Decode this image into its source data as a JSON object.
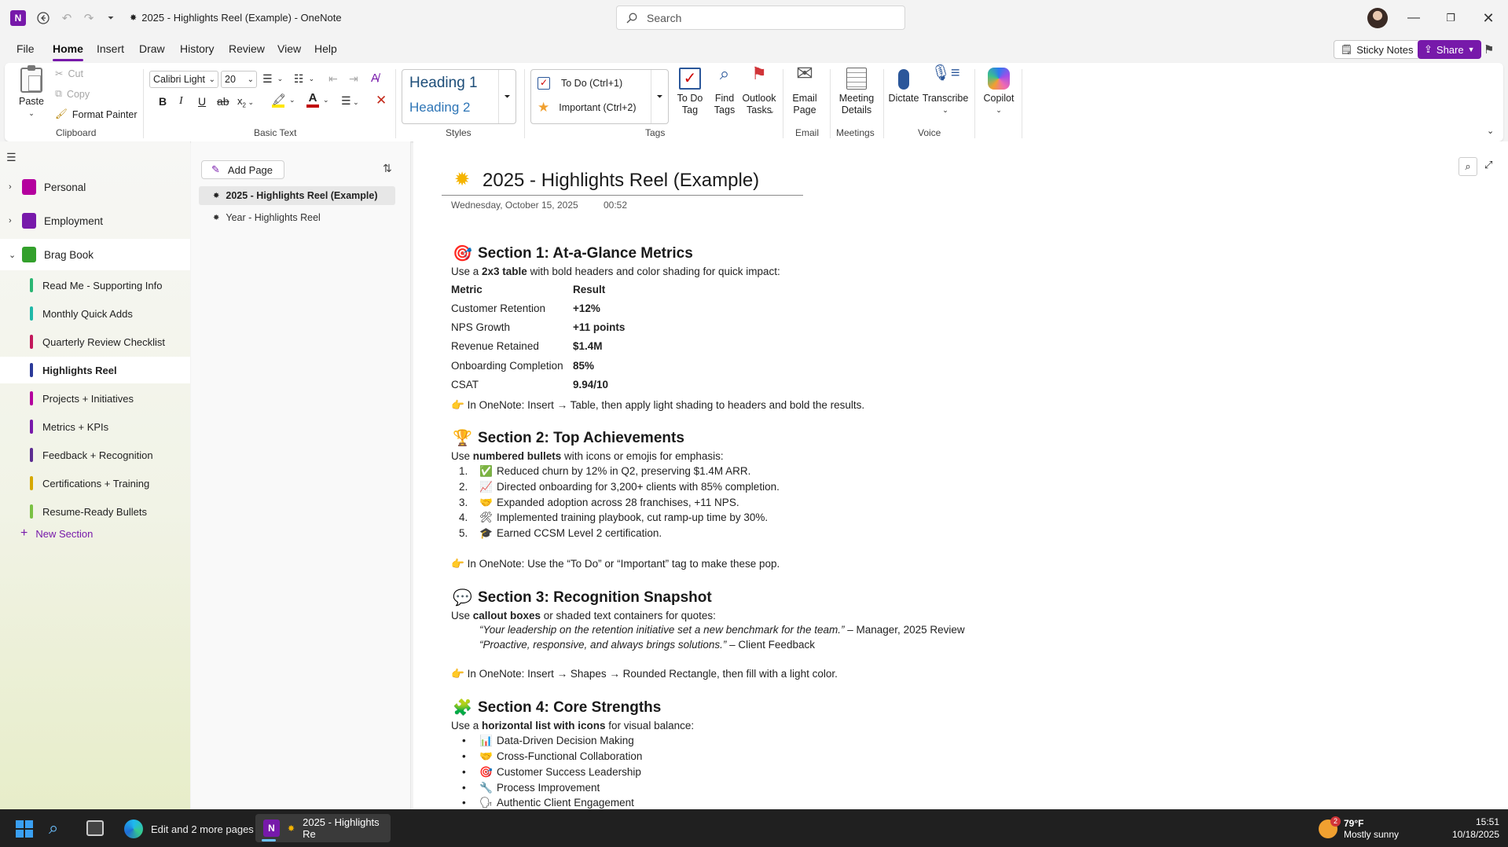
{
  "window": {
    "title": "2025 - Highlights Reel (Example)  -  OneNote",
    "search_placeholder": "Search"
  },
  "menu": [
    "File",
    "Home",
    "Insert",
    "Draw",
    "History",
    "Review",
    "View",
    "Help"
  ],
  "menu_right": {
    "sticky_notes": "Sticky Notes",
    "share": "Share"
  },
  "ribbon": {
    "clipboard": {
      "paste": "Paste",
      "cut": "Cut",
      "copy": "Copy",
      "format_painter": "Format Painter",
      "label": "Clipboard"
    },
    "basic_text": {
      "font": "Calibri Light",
      "size": "20",
      "label": "Basic Text"
    },
    "styles": {
      "h1": "Heading 1",
      "h2": "Heading 2",
      "label": "Styles"
    },
    "tags": {
      "todo": "To Do (Ctrl+1)",
      "important": "Important (Ctrl+2)",
      "todo_tag": "To Do Tag",
      "find_tags": "Find Tags",
      "outlook_tasks": "Outlook Tasks",
      "label": "Tags"
    },
    "email": {
      "email_page": "Email Page",
      "label": "Email"
    },
    "meetings": {
      "meeting_details": "Meeting Details",
      "label": "Meetings"
    },
    "voice": {
      "dictate": "Dictate",
      "transcribe": "Transcribe",
      "label": "Voice"
    },
    "copilot": {
      "label": "Copilot"
    }
  },
  "notebooks": [
    {
      "name": "Personal",
      "color": "#b4009e"
    },
    {
      "name": "Employment",
      "color": "#7719aa"
    },
    {
      "name": "Brag Book",
      "color": "#33a02c"
    }
  ],
  "sections": [
    {
      "name": "Read Me - Supporting Info",
      "color": "#2bb673"
    },
    {
      "name": "Monthly Quick Adds",
      "color": "#1fb8a8"
    },
    {
      "name": "Quarterly Review Checklist",
      "color": "#c2185b"
    },
    {
      "name": "Highlights Reel",
      "color": "#2b3a99"
    },
    {
      "name": "Projects + Initiatives",
      "color": "#b4009e"
    },
    {
      "name": "Metrics + KPIs",
      "color": "#7719aa"
    },
    {
      "name": "Feedback + Recognition",
      "color": "#5c2d91"
    },
    {
      "name": "Certifications + Training",
      "color": "#d6a800"
    },
    {
      "name": "Resume-Ready Bullets",
      "color": "#7ac143"
    }
  ],
  "new_section": "New Section",
  "pages": {
    "add_page": "Add Page",
    "items": [
      "2025 - Highlights Reel (Example)",
      "Year - Highlights Reel"
    ]
  },
  "note": {
    "title": "2025 - Highlights Reel (Example)",
    "date": "Wednesday, October 15, 2025",
    "time": "00:52",
    "s1": {
      "heading": "Section 1: At-a-Glance Metrics",
      "intro_pre": "Use a ",
      "intro_bold": "2x3 table",
      "intro_post": " with bold headers and color shading for quick impact:",
      "header": [
        "Metric",
        "Result"
      ],
      "rows": [
        [
          "Customer Retention",
          "+12%"
        ],
        [
          "NPS Growth",
          "+11 points"
        ],
        [
          "Revenue Retained",
          "$1.4M"
        ],
        [
          "Onboarding Completion",
          "85%"
        ],
        [
          "CSAT",
          "9.94/10"
        ]
      ],
      "tip": "In OneNote: Insert → Table, then apply light shading to headers and bold the results."
    },
    "s2": {
      "heading": "Section 2: Top Achievements",
      "intro_pre": "Use ",
      "intro_bold": "numbered bullets",
      "intro_post": " with icons or emojis for emphasis:",
      "items": [
        {
          "n": "1.",
          "icon": "✅",
          "text": "Reduced churn by 12% in Q2, preserving $1.4M ARR."
        },
        {
          "n": "2.",
          "icon": "📈",
          "text": "Directed onboarding for 3,200+ clients with 85% completion."
        },
        {
          "n": "3.",
          "icon": "🤝",
          "text": "Expanded adoption across 28 franchises, +11 NPS."
        },
        {
          "n": "4.",
          "icon": "🛠",
          "text": "Implemented training playbook, cut ramp-up time by 30%."
        },
        {
          "n": "5.",
          "icon": "🎓",
          "text": "Earned CCSM Level 2 certification."
        }
      ],
      "tip": "In OneNote: Use the “To Do” or “Important” tag to make these pop."
    },
    "s3": {
      "heading": "Section 3: Recognition Snapshot",
      "intro_pre": "Use ",
      "intro_bold": "callout boxes",
      "intro_post": " or shaded text containers for quotes:",
      "quotes": [
        {
          "q": "“Your leadership on the retention initiative set a new benchmark for the team.”",
          "by": " – Manager, 2025 Review"
        },
        {
          "q": "“Proactive, responsive, and always brings solutions.”",
          "by": " – Client Feedback"
        }
      ],
      "tip": "In OneNote: Insert → Shapes → Rounded Rectangle, then fill with a light color."
    },
    "s4": {
      "heading": "Section 4: Core Strengths",
      "intro_pre": "Use a ",
      "intro_bold": "horizontal list with icons",
      "intro_post": " for visual balance:",
      "items": [
        {
          "icon": "📊",
          "text": "Data-Driven Decision Making"
        },
        {
          "icon": "🤝",
          "text": "Cross-Functional Collaboration"
        },
        {
          "icon": "🎯",
          "text": "Customer Success Leadership"
        },
        {
          "icon": "🔧",
          "text": "Process Improvement"
        },
        {
          "icon": "🗣",
          "text": "Authentic Client Engagement"
        }
      ]
    }
  },
  "taskbar": {
    "edge_label": "Edit and 2 more pages -",
    "onenote_label": "2025 - Highlights Re",
    "weather_temp": "79°F",
    "weather_desc": "Mostly sunny",
    "weather_badge": "2",
    "time": "15:51",
    "date": "10/18/2025"
  }
}
